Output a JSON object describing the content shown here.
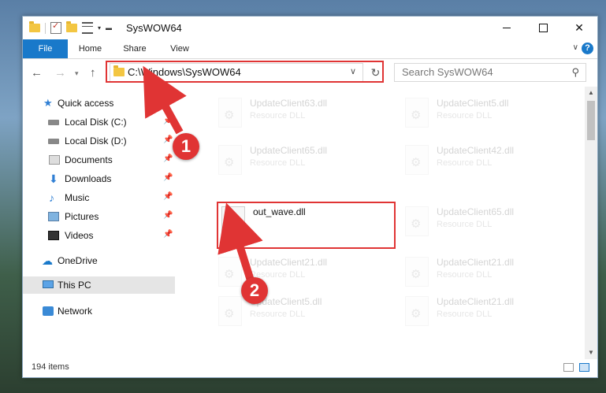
{
  "window": {
    "title": "SysWOW64",
    "minimize": "",
    "maximize": "",
    "close": "✕"
  },
  "ribbon": {
    "tabs": [
      "File",
      "Home",
      "Share",
      "View"
    ],
    "help": "?"
  },
  "navbar": {
    "address": "C:\\Windows\\SysWOW64",
    "search_placeholder": "Search SysWOW64"
  },
  "navpane": {
    "items": [
      {
        "label": "Quick access",
        "icon": "star-icon"
      },
      {
        "label": "Local Disk (C:)",
        "icon": "disk-icon",
        "pinned": true
      },
      {
        "label": "Local Disk (D:)",
        "icon": "disk-icon",
        "pinned": true
      },
      {
        "label": "Documents",
        "icon": "documents-icon",
        "pinned": true
      },
      {
        "label": "Downloads",
        "icon": "download-icon",
        "pinned": true
      },
      {
        "label": "Music",
        "icon": "music-icon",
        "pinned": true
      },
      {
        "label": "Pictures",
        "icon": "pictures-icon",
        "pinned": true
      },
      {
        "label": "Videos",
        "icon": "videos-icon",
        "pinned": true
      },
      {
        "label": "OneDrive",
        "icon": "cloud-icon"
      },
      {
        "label": "This PC",
        "icon": "computer-icon",
        "selected": true
      },
      {
        "label": "Network",
        "icon": "network-icon"
      }
    ]
  },
  "files": [
    {
      "name": "UpdateClient63.dll",
      "type": "Resource DLL"
    },
    {
      "name": "UpdateClient5.dll",
      "type": "Resource DLL"
    },
    {
      "name": "UpdateClient65.dll",
      "type": "Resource DLL"
    },
    {
      "name": "UpdateClient42.dll",
      "type": "Resource DLL"
    },
    {
      "name": "out_wave.dll",
      "type": ""
    },
    {
      "name": "UpdateClient65.dll",
      "type": "Resource DLL"
    },
    {
      "name": "UpdateClient21.dll",
      "type": "Resource DLL"
    },
    {
      "name": "UpdateClient21.dll",
      "type": "Resource DLL"
    },
    {
      "name": "UpdateClient5.dll",
      "type": "Resource DLL"
    },
    {
      "name": "UpdateClient21.dll",
      "type": "Resource DLL"
    }
  ],
  "status": {
    "item_count": "194 items"
  },
  "annotations": {
    "step1": "1",
    "step2": "2",
    "color": "#e03434"
  }
}
